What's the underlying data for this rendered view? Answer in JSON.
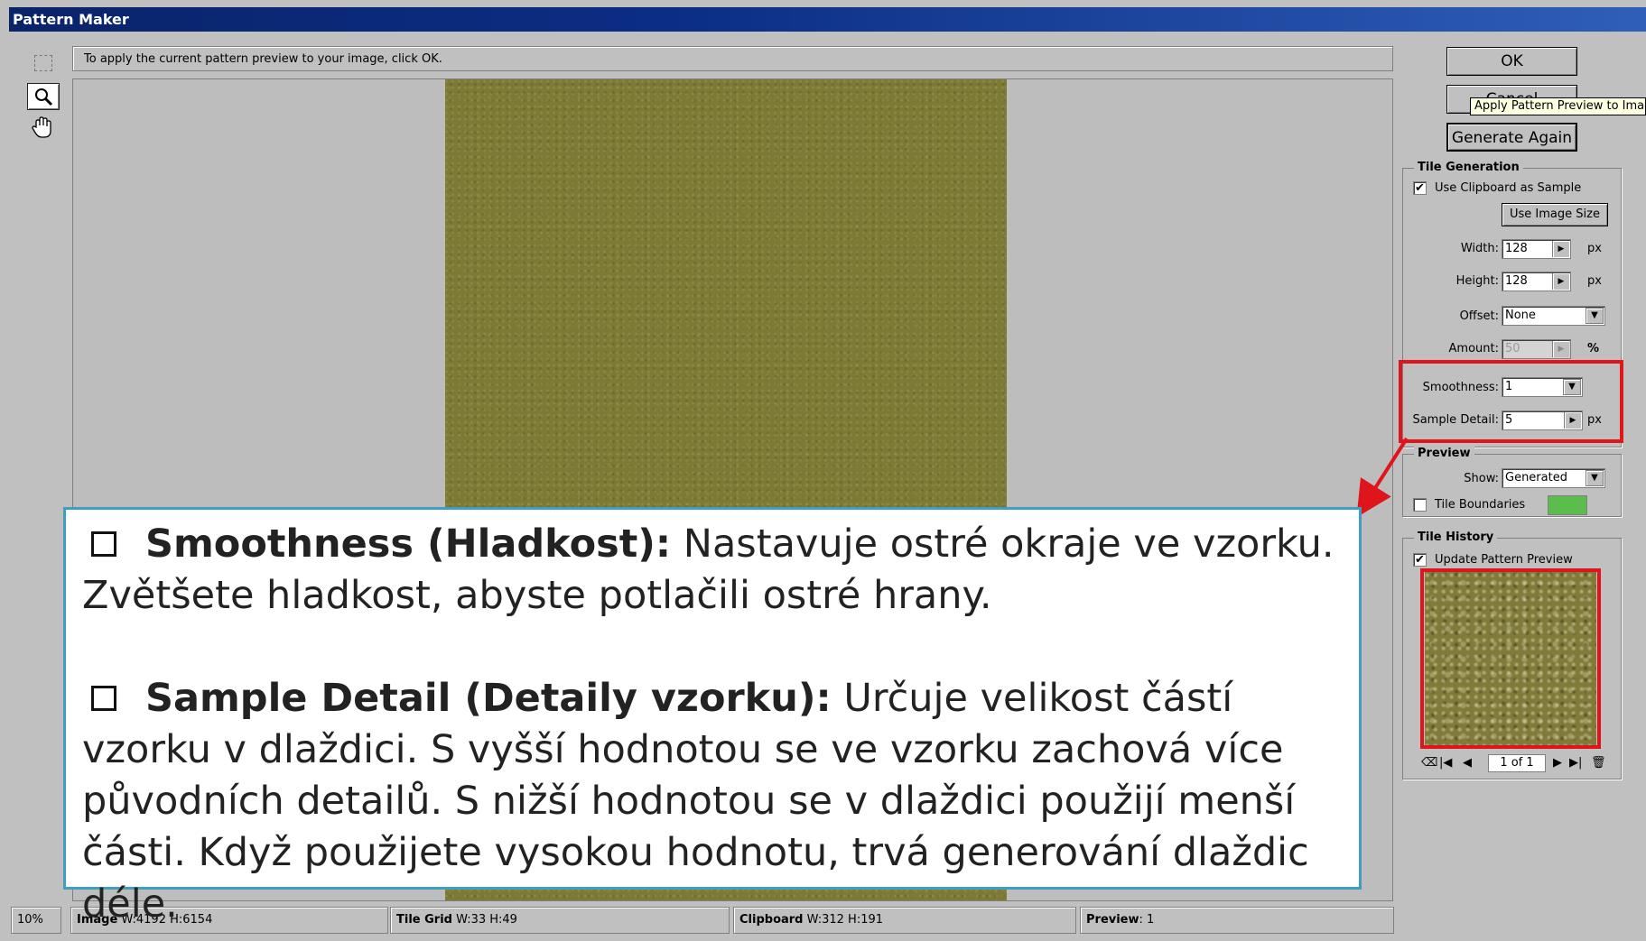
{
  "window": {
    "title": "Pattern Maker"
  },
  "message": "To apply the current pattern preview to your image, click OK.",
  "buttons": {
    "ok": "OK",
    "cancel": "Cancel",
    "generate_again": "Generate Again",
    "use_image_size": "Use Image Size"
  },
  "tooltip": "Apply Pattern Preview to Image",
  "tile_generation": {
    "title": "Tile Generation",
    "use_clipboard_label": "Use Clipboard as Sample",
    "use_clipboard_checked": "✔",
    "width_label": "Width:",
    "width_value": "128",
    "height_label": "Height:",
    "height_value": "128",
    "offset_label": "Offset:",
    "offset_value": "None",
    "amount_label": "Amount:",
    "amount_value": "50",
    "smoothness_label": "Smoothness:",
    "smoothness_value": "1",
    "sample_detail_label": "Sample Detail:",
    "sample_detail_value": "5",
    "unit_px": "px",
    "unit_percent": "%"
  },
  "preview": {
    "title": "Preview",
    "show_label": "Show:",
    "show_value": "Generated",
    "tile_boundaries_label": "Tile Boundaries",
    "tile_boundaries_color": "#5bbe4c"
  },
  "tile_history": {
    "title": "Tile History",
    "update_label": "Update Pattern Preview",
    "update_checked": "✔",
    "page": "1 of 1"
  },
  "status": {
    "zoom": "10%",
    "image_label": "Image",
    "image_value": "W:4192 H:6154",
    "tile_grid_label": "Tile Grid",
    "tile_grid_value": "W:33 H:49",
    "clipboard_label": "Clipboard",
    "clipboard_value": "W:312 H:191",
    "preview_label": "Preview",
    "preview_value": ": 1"
  },
  "callout": {
    "item1_title": "Smoothness (Hladkost):",
    "item1_text": " Nastavuje ostré okraje ve vzorku. Zvětšete hladkost, abyste potlačili ostré hrany.",
    "item2_title": "Sample Detail (Detaily vzorku):",
    "item2_text": " Určuje velikost částí vzorku v dlaždici. S vyšší hodnotou se ve vzorku zachová více původních detailů. S nižší hodnotou se v dlaždici použijí menší části. Když použijete vysokou hodnotu, trvá generování dlaždic déle."
  },
  "colors": {
    "highlight": "#e0151b",
    "callout_border": "#3f9ec2",
    "titlebar": "#0a246a"
  }
}
